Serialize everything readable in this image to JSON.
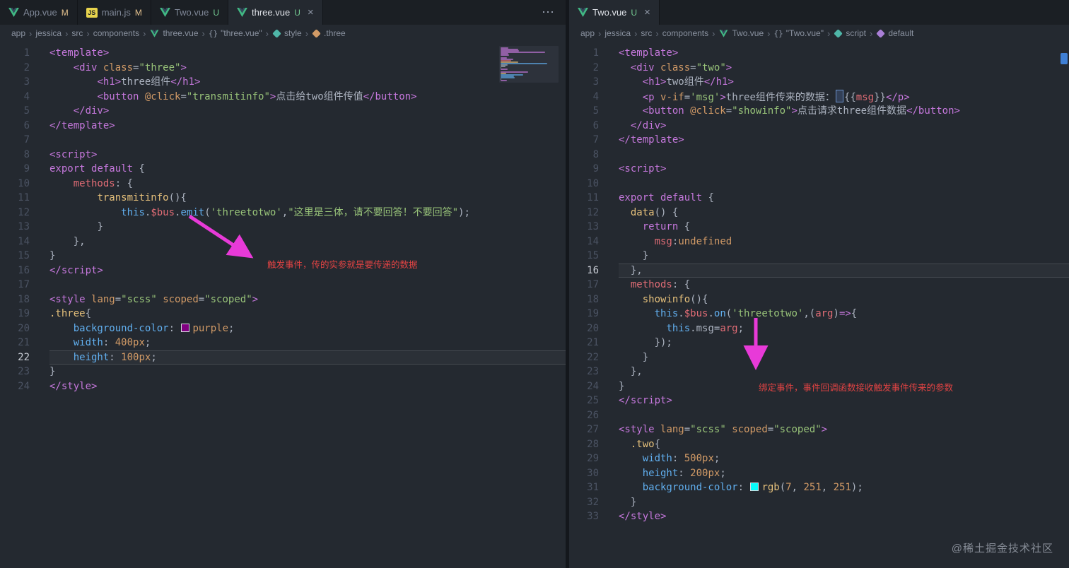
{
  "watermark": "@稀土掘金技术社区",
  "colors": {
    "arrow": "#e83ad8",
    "annotation": "#e04343",
    "git_modified": "#e2c08d",
    "git_untracked": "#73c991"
  },
  "left": {
    "tabs": [
      {
        "label": "App.vue",
        "icon": "vue",
        "git": "M",
        "active": false
      },
      {
        "label": "main.js",
        "icon": "js",
        "git": "M",
        "active": false
      },
      {
        "label": "Two.vue",
        "icon": "vue",
        "git": "U",
        "active": false
      },
      {
        "label": "three.vue",
        "icon": "vue",
        "git": "U",
        "active": true,
        "close": "×"
      }
    ],
    "actions_icon": "⋯",
    "breadcrumb": [
      {
        "label": "app"
      },
      {
        "label": "jessica"
      },
      {
        "label": "src"
      },
      {
        "label": "components"
      },
      {
        "label": "three.vue",
        "icon": "vue"
      },
      {
        "label": "\"three.vue\"",
        "icon": "braces"
      },
      {
        "label": "style",
        "icon": "symbol-style"
      },
      {
        "label": ".three",
        "icon": "symbol-class"
      }
    ],
    "current_line": 22,
    "annotation": "触发事件，传的实参就是要传递的数据",
    "lines": [
      [
        {
          "t": "<template>",
          "c": "tag"
        }
      ],
      [
        {
          "t": "    ",
          "c": "ws"
        },
        {
          "t": "<div ",
          "c": "tag"
        },
        {
          "t": "class",
          "c": "attr"
        },
        {
          "t": "=",
          "c": "w"
        },
        {
          "t": "\"three\"",
          "c": "str"
        },
        {
          "t": ">",
          "c": "tag"
        }
      ],
      [
        {
          "t": "        ",
          "c": "ws"
        },
        {
          "t": "<h1>",
          "c": "tag"
        },
        {
          "t": "three组件",
          "c": "w"
        },
        {
          "t": "</h1>",
          "c": "tag"
        }
      ],
      [
        {
          "t": "        ",
          "c": "ws"
        },
        {
          "t": "<button ",
          "c": "tag"
        },
        {
          "t": "@click",
          "c": "attr"
        },
        {
          "t": "=",
          "c": "w"
        },
        {
          "t": "\"transmitinfo\"",
          "c": "str"
        },
        {
          "t": ">",
          "c": "tag"
        },
        {
          "t": "点击给two组件传值",
          "c": "w"
        },
        {
          "t": "</button>",
          "c": "tag"
        }
      ],
      [
        {
          "t": "    ",
          "c": "ws"
        },
        {
          "t": "</div>",
          "c": "tag"
        }
      ],
      [
        {
          "t": "</template>",
          "c": "tag"
        }
      ],
      [],
      [
        {
          "t": "<script>",
          "c": "tag"
        }
      ],
      [
        {
          "t": "export",
          "c": "kw"
        },
        {
          "t": " ",
          "c": "w"
        },
        {
          "t": "default",
          "c": "kw"
        },
        {
          "t": " {",
          "c": "w"
        }
      ],
      [
        {
          "t": "    ",
          "c": "ws"
        },
        {
          "t": "methods",
          "c": "prop"
        },
        {
          "t": ": {",
          "c": "w"
        }
      ],
      [
        {
          "t": "        ",
          "c": "ws"
        },
        {
          "t": "transmitinfo",
          "c": "fn"
        },
        {
          "t": "(){",
          "c": "w"
        }
      ],
      [
        {
          "t": "            ",
          "c": "ws"
        },
        {
          "t": "this",
          "c": "th"
        },
        {
          "t": ".",
          "c": "w"
        },
        {
          "t": "$bus",
          "c": "prop"
        },
        {
          "t": ".",
          "c": "w"
        },
        {
          "t": "emit",
          "c": "th"
        },
        {
          "t": "(",
          "c": "w"
        },
        {
          "t": "'threetotwo'",
          "c": "str"
        },
        {
          "t": ",",
          "c": "w"
        },
        {
          "t": "\"这里是三体，请不要回答！不要回答\"",
          "c": "str"
        },
        {
          "t": ");",
          "c": "w"
        }
      ],
      [
        {
          "t": "        ",
          "c": "ws"
        },
        {
          "t": "}",
          "c": "w"
        }
      ],
      [
        {
          "t": "    ",
          "c": "ws"
        },
        {
          "t": "},",
          "c": "w"
        }
      ],
      [
        {
          "t": "}",
          "c": "w"
        }
      ],
      [
        {
          "t": "</script>",
          "c": "tag"
        }
      ],
      [],
      [
        {
          "t": "<style ",
          "c": "tag"
        },
        {
          "t": "lang",
          "c": "attr"
        },
        {
          "t": "=",
          "c": "w"
        },
        {
          "t": "\"scss\"",
          "c": "str"
        },
        {
          "t": " ",
          "c": "w"
        },
        {
          "t": "scoped",
          "c": "attr"
        },
        {
          "t": "=",
          "c": "w"
        },
        {
          "t": "\"scoped\"",
          "c": "str"
        },
        {
          "t": ">",
          "c": "tag"
        }
      ],
      [
        {
          "t": ".three",
          "c": "fn"
        },
        {
          "t": "{",
          "c": "w"
        }
      ],
      [
        {
          "t": "    ",
          "c": "ws"
        },
        {
          "t": "background-color",
          "c": "th"
        },
        {
          "t": ": ",
          "c": "w"
        },
        {
          "t": "",
          "c": "swatch",
          "color": "#800080"
        },
        {
          "t": "purple",
          "c": "num"
        },
        {
          "t": ";",
          "c": "w"
        }
      ],
      [
        {
          "t": "    ",
          "c": "ws"
        },
        {
          "t": "width",
          "c": "th"
        },
        {
          "t": ": ",
          "c": "w"
        },
        {
          "t": "400px",
          "c": "num"
        },
        {
          "t": ";",
          "c": "w"
        }
      ],
      [
        {
          "t": "    ",
          "c": "ws"
        },
        {
          "t": "height",
          "c": "th"
        },
        {
          "t": ": ",
          "c": "w"
        },
        {
          "t": "100px",
          "c": "num"
        },
        {
          "t": ";",
          "c": "w"
        }
      ],
      [
        {
          "t": "}",
          "c": "w"
        }
      ],
      [
        {
          "t": "</style>",
          "c": "tag"
        }
      ]
    ]
  },
  "right": {
    "tabs": [
      {
        "label": "Two.vue",
        "icon": "vue",
        "git": "U",
        "active": true,
        "close": "×"
      }
    ],
    "breadcrumb": [
      {
        "label": "app"
      },
      {
        "label": "jessica"
      },
      {
        "label": "src"
      },
      {
        "label": "components"
      },
      {
        "label": "Two.vue",
        "icon": "vue"
      },
      {
        "label": "\"Two.vue\"",
        "icon": "braces"
      },
      {
        "label": "script",
        "icon": "symbol-script"
      },
      {
        "label": "default",
        "icon": "symbol-default"
      }
    ],
    "current_line": 16,
    "annotation": "绑定事件，事件回调函数接收触发事件传来的参数",
    "lines": [
      [
        {
          "t": "<template>",
          "c": "tag"
        }
      ],
      [
        {
          "t": "  ",
          "c": "ws"
        },
        {
          "t": "<div ",
          "c": "tag"
        },
        {
          "t": "class",
          "c": "attr"
        },
        {
          "t": "=",
          "c": "w"
        },
        {
          "t": "\"two\"",
          "c": "str"
        },
        {
          "t": ">",
          "c": "tag"
        }
      ],
      [
        {
          "t": "    ",
          "c": "ws"
        },
        {
          "t": "<h1>",
          "c": "tag"
        },
        {
          "t": "two组件",
          "c": "w"
        },
        {
          "t": "</h1>",
          "c": "tag"
        }
      ],
      [
        {
          "t": "    ",
          "c": "ws"
        },
        {
          "t": "<p ",
          "c": "tag"
        },
        {
          "t": "v-if",
          "c": "attr"
        },
        {
          "t": "=",
          "c": "w"
        },
        {
          "t": "'msg'",
          "c": "str"
        },
        {
          "t": ">",
          "c": "tag"
        },
        {
          "t": "three组件传来的数据：",
          "c": "w"
        },
        {
          "t": "",
          "c": "cursor"
        },
        {
          "t": "{{",
          "c": "w"
        },
        {
          "t": "msg",
          "c": "prop"
        },
        {
          "t": "}}",
          "c": "w"
        },
        {
          "t": "</p>",
          "c": "tag"
        }
      ],
      [
        {
          "t": "    ",
          "c": "ws"
        },
        {
          "t": "<button ",
          "c": "tag"
        },
        {
          "t": "@click",
          "c": "attr"
        },
        {
          "t": "=",
          "c": "w"
        },
        {
          "t": "\"showinfo\"",
          "c": "str"
        },
        {
          "t": ">",
          "c": "tag"
        },
        {
          "t": "点击请求three组件数据",
          "c": "w"
        },
        {
          "t": "</button>",
          "c": "tag"
        }
      ],
      [
        {
          "t": "  ",
          "c": "ws"
        },
        {
          "t": "</div>",
          "c": "tag"
        }
      ],
      [
        {
          "t": "</template>",
          "c": "tag"
        }
      ],
      [],
      [
        {
          "t": "<script>",
          "c": "tag"
        }
      ],
      [],
      [
        {
          "t": "export",
          "c": "kw"
        },
        {
          "t": " ",
          "c": "w"
        },
        {
          "t": "default",
          "c": "kw"
        },
        {
          "t": " {",
          "c": "w"
        }
      ],
      [
        {
          "t": "  ",
          "c": "ws"
        },
        {
          "t": "data",
          "c": "fn"
        },
        {
          "t": "() {",
          "c": "w"
        }
      ],
      [
        {
          "t": "    ",
          "c": "ws"
        },
        {
          "t": "return",
          "c": "kw"
        },
        {
          "t": " {",
          "c": "w"
        }
      ],
      [
        {
          "t": "      ",
          "c": "ws"
        },
        {
          "t": "msg",
          "c": "prop"
        },
        {
          "t": ":",
          "c": "w"
        },
        {
          "t": "undefined",
          "c": "num"
        }
      ],
      [
        {
          "t": "    ",
          "c": "ws"
        },
        {
          "t": "}",
          "c": "w"
        }
      ],
      [
        {
          "t": "  ",
          "c": "ws"
        },
        {
          "t": "},",
          "c": "w"
        }
      ],
      [
        {
          "t": "  ",
          "c": "ws"
        },
        {
          "t": "methods",
          "c": "prop"
        },
        {
          "t": ": {",
          "c": "w"
        }
      ],
      [
        {
          "t": "    ",
          "c": "ws"
        },
        {
          "t": "showinfo",
          "c": "fn"
        },
        {
          "t": "(){",
          "c": "w"
        }
      ],
      [
        {
          "t": "      ",
          "c": "ws"
        },
        {
          "t": "this",
          "c": "th"
        },
        {
          "t": ".",
          "c": "w"
        },
        {
          "t": "$bus",
          "c": "prop"
        },
        {
          "t": ".",
          "c": "w"
        },
        {
          "t": "on",
          "c": "th"
        },
        {
          "t": "(",
          "c": "w"
        },
        {
          "t": "'threetotwo'",
          "c": "str"
        },
        {
          "t": ",(",
          "c": "w"
        },
        {
          "t": "arg",
          "c": "prop"
        },
        {
          "t": ")",
          "c": "w"
        },
        {
          "t": "=>",
          "c": "kw"
        },
        {
          "t": "{",
          "c": "w"
        }
      ],
      [
        {
          "t": "        ",
          "c": "ws"
        },
        {
          "t": "this",
          "c": "th"
        },
        {
          "t": ".",
          "c": "w"
        },
        {
          "t": "msg",
          "c": "w"
        },
        {
          "t": "=",
          "c": "w"
        },
        {
          "t": "arg",
          "c": "prop"
        },
        {
          "t": ";",
          "c": "w"
        }
      ],
      [
        {
          "t": "      ",
          "c": "ws"
        },
        {
          "t": "});",
          "c": "w"
        }
      ],
      [
        {
          "t": "    ",
          "c": "ws"
        },
        {
          "t": "}",
          "c": "w"
        }
      ],
      [
        {
          "t": "  ",
          "c": "ws"
        },
        {
          "t": "},",
          "c": "w"
        }
      ],
      [
        {
          "t": "}",
          "c": "w"
        }
      ],
      [
        {
          "t": "</script>",
          "c": "tag"
        }
      ],
      [],
      [
        {
          "t": "<style ",
          "c": "tag"
        },
        {
          "t": "lang",
          "c": "attr"
        },
        {
          "t": "=",
          "c": "w"
        },
        {
          "t": "\"scss\"",
          "c": "str"
        },
        {
          "t": " ",
          "c": "w"
        },
        {
          "t": "scoped",
          "c": "attr"
        },
        {
          "t": "=",
          "c": "w"
        },
        {
          "t": "\"scoped\"",
          "c": "str"
        },
        {
          "t": ">",
          "c": "tag"
        }
      ],
      [
        {
          "t": "  ",
          "c": "ws"
        },
        {
          "t": ".two",
          "c": "fn"
        },
        {
          "t": "{",
          "c": "w"
        }
      ],
      [
        {
          "t": "    ",
          "c": "ws"
        },
        {
          "t": "width",
          "c": "th"
        },
        {
          "t": ": ",
          "c": "w"
        },
        {
          "t": "500px",
          "c": "num"
        },
        {
          "t": ";",
          "c": "w"
        }
      ],
      [
        {
          "t": "    ",
          "c": "ws"
        },
        {
          "t": "height",
          "c": "th"
        },
        {
          "t": ": ",
          "c": "w"
        },
        {
          "t": "200px",
          "c": "num"
        },
        {
          "t": ";",
          "c": "w"
        }
      ],
      [
        {
          "t": "    ",
          "c": "ws"
        },
        {
          "t": "background-color",
          "c": "th"
        },
        {
          "t": ": ",
          "c": "w"
        },
        {
          "t": "",
          "c": "swatch",
          "color": "#07fbfb"
        },
        {
          "t": "rgb",
          "c": "fn"
        },
        {
          "t": "(",
          "c": "w"
        },
        {
          "t": "7",
          "c": "num"
        },
        {
          "t": ", ",
          "c": "w"
        },
        {
          "t": "251",
          "c": "num"
        },
        {
          "t": ", ",
          "c": "w"
        },
        {
          "t": "251",
          "c": "num"
        },
        {
          "t": ");",
          "c": "w"
        }
      ],
      [
        {
          "t": "  ",
          "c": "ws"
        },
        {
          "t": "}",
          "c": "w"
        }
      ],
      [
        {
          "t": "</style>",
          "c": "tag"
        }
      ]
    ]
  }
}
